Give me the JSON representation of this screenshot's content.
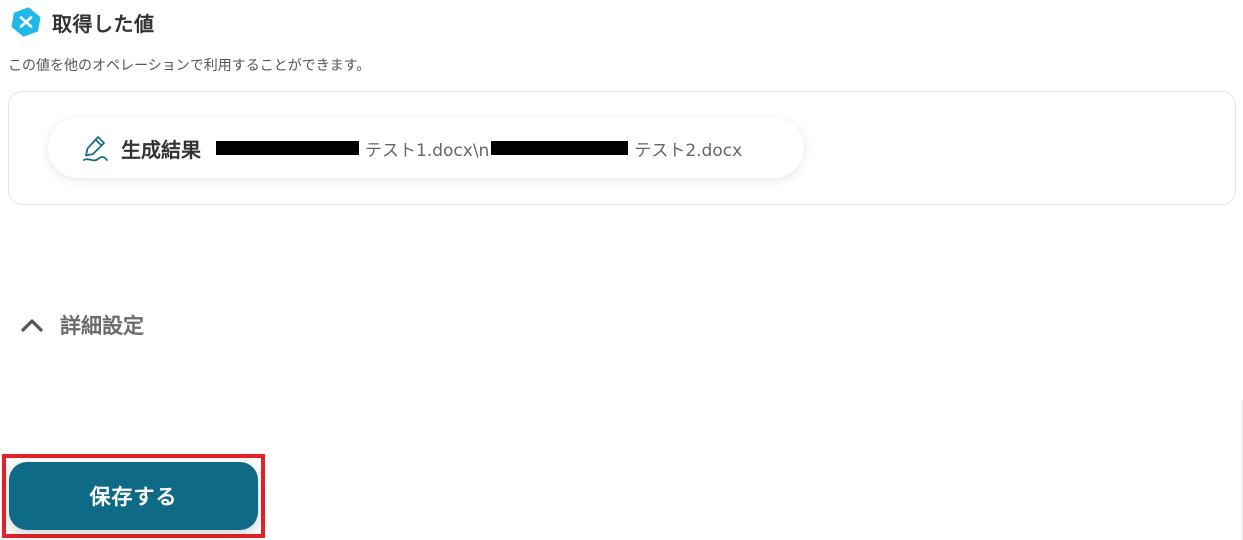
{
  "section": {
    "title": "取得した値",
    "description": "この値を他のオペレーションで利用することができます。",
    "logo_icon": "yoom-x-logo-icon",
    "accent_color": "#1fb8e8"
  },
  "value_chip": {
    "icon": "pen-signature-icon",
    "label": "生成結果",
    "value_part_1": "テスト1.docx\\n",
    "value_part_2": "テスト2.docx"
  },
  "details": {
    "icon": "chevron-up-icon",
    "label": "詳細設定"
  },
  "save": {
    "label": "保存する",
    "color": "#0e6a86",
    "highlight_color": "#e4222b"
  }
}
